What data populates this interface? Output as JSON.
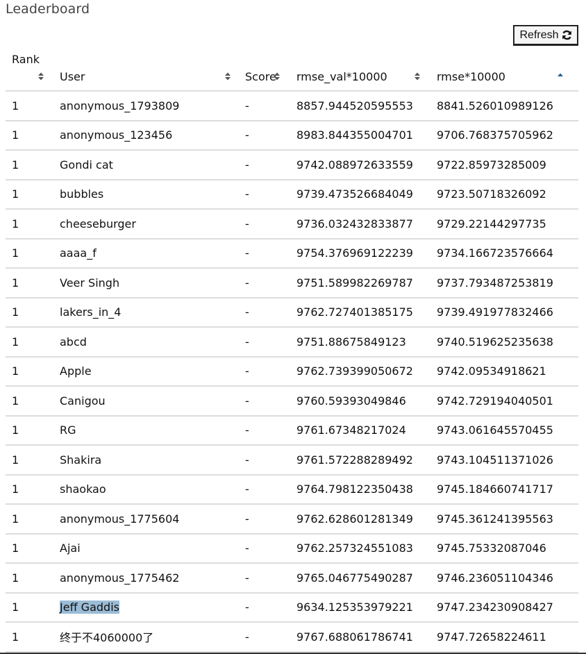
{
  "page": {
    "title": "Leaderboard",
    "refresh_button": {
      "label": "Refresh",
      "icon": "refresh-icon"
    }
  },
  "table": {
    "columns": [
      {
        "key": "rank",
        "label": "Rank",
        "sort_state": "unsorted"
      },
      {
        "key": "user",
        "label": "User",
        "sort_state": "unsorted"
      },
      {
        "key": "score",
        "label": "Score",
        "sort_state": "unsorted"
      },
      {
        "key": "rmse_val",
        "label": "rmse_val*10000",
        "sort_state": "unsorted"
      },
      {
        "key": "rmse",
        "label": "rmse*10000",
        "sort_state": "ascending"
      }
    ],
    "rows": [
      {
        "rank": "1",
        "user": "anonymous_1793809",
        "score": "-",
        "rmse_val": "8857.944520595553",
        "rmse": "8841.526010989126"
      },
      {
        "rank": "1",
        "user": "anonymous_123456",
        "score": "-",
        "rmse_val": "8983.844355004701",
        "rmse": "9706.768375705962"
      },
      {
        "rank": "1",
        "user": "Gondi cat",
        "score": "-",
        "rmse_val": "9742.088972633559",
        "rmse": "9722.85973285009"
      },
      {
        "rank": "1",
        "user": "bubbles",
        "score": "-",
        "rmse_val": "9739.473526684049",
        "rmse": "9723.50718326092"
      },
      {
        "rank": "1",
        "user": "cheeseburger",
        "score": "-",
        "rmse_val": "9736.032432833877",
        "rmse": "9729.22144297735"
      },
      {
        "rank": "1",
        "user": "aaaa_f",
        "score": "-",
        "rmse_val": "9754.376969122239",
        "rmse": "9734.166723576664"
      },
      {
        "rank": "1",
        "user": "Veer Singh",
        "score": "-",
        "rmse_val": "9751.589982269787",
        "rmse": "9737.793487253819"
      },
      {
        "rank": "1",
        "user": "lakers_in_4",
        "score": "-",
        "rmse_val": "9762.727401385175",
        "rmse": "9739.491977832466"
      },
      {
        "rank": "1",
        "user": "abcd",
        "score": "-",
        "rmse_val": "9751.88675849123",
        "rmse": "9740.519625235638"
      },
      {
        "rank": "1",
        "user": "Apple",
        "score": "-",
        "rmse_val": "9762.739399050672",
        "rmse": "9742.09534918621"
      },
      {
        "rank": "1",
        "user": "Canigou",
        "score": "-",
        "rmse_val": "9760.59393049846",
        "rmse": "9742.729194040501"
      },
      {
        "rank": "1",
        "user": "RG",
        "score": "-",
        "rmse_val": "9761.67348217024",
        "rmse": "9743.061645570455"
      },
      {
        "rank": "1",
        "user": "Shakira",
        "score": "-",
        "rmse_val": "9761.572288289492",
        "rmse": "9743.104511371026"
      },
      {
        "rank": "1",
        "user": "shaokao",
        "score": "-",
        "rmse_val": "9764.798122350438",
        "rmse": "9745.184660741717"
      },
      {
        "rank": "1",
        "user": "anonymous_1775604",
        "score": "-",
        "rmse_val": "9762.628601281349",
        "rmse": "9745.361241395563"
      },
      {
        "rank": "1",
        "user": "Ajai",
        "score": "-",
        "rmse_val": "9762.257324551083",
        "rmse": "9745.75332087046"
      },
      {
        "rank": "1",
        "user": "anonymous_1775462",
        "score": "-",
        "rmse_val": "9765.046775490287",
        "rmse": "9746.236051104346"
      },
      {
        "rank": "1",
        "user": "Jeff Gaddis",
        "score": "-",
        "rmse_val": "9634.125353979221",
        "rmse": "9747.234230908427",
        "user_selected": true
      },
      {
        "rank": "1",
        "user": "终于不4060000了",
        "score": "-",
        "rmse_val": "9767.688061786741",
        "rmse": "9747.72658224611"
      }
    ]
  },
  "colors": {
    "row_divider": "#dddddd",
    "selection_highlight": "#9bbcd6",
    "sort_icon": "#555555"
  }
}
